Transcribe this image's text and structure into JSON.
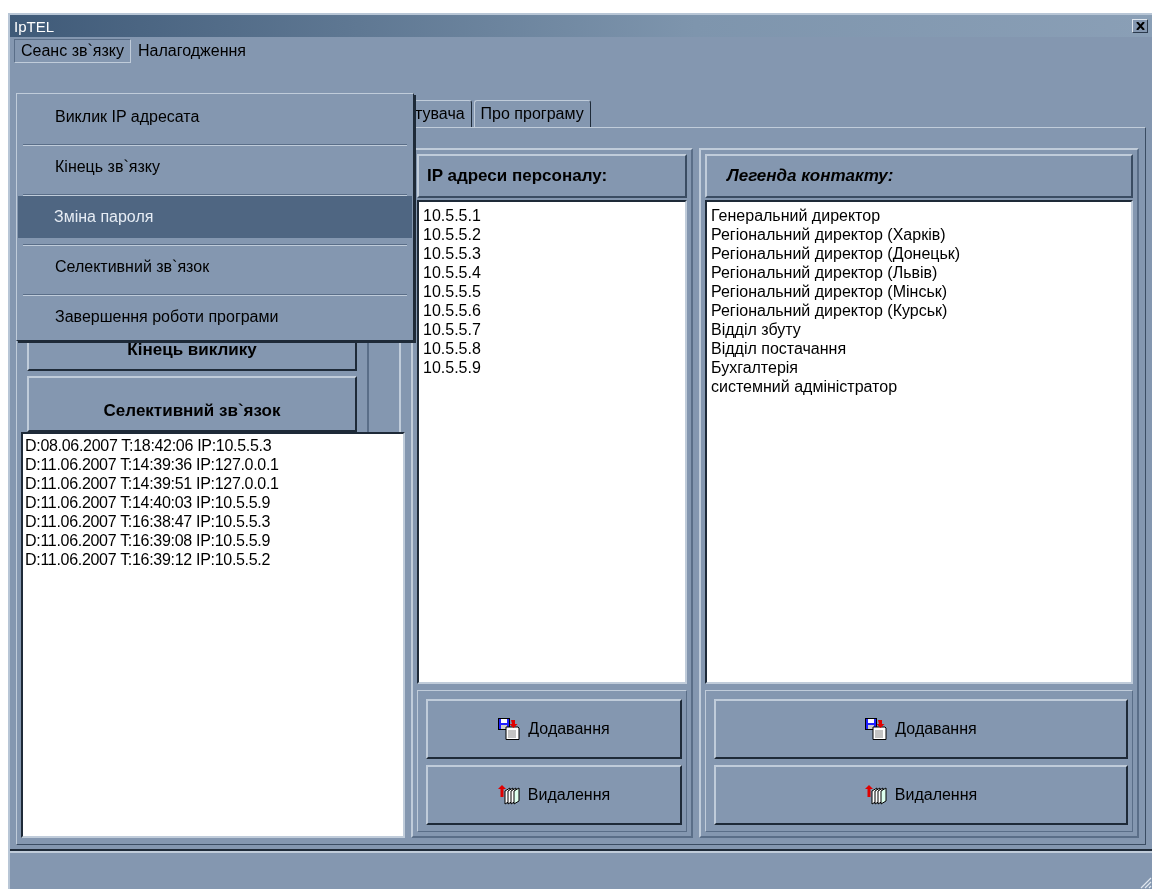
{
  "window": {
    "title": "IpTEL"
  },
  "menu_bar": [
    {
      "label": "Сеанс зв`язку",
      "selected": true
    },
    {
      "label": "Налагодження",
      "selected": false
    }
  ],
  "dropdown": [
    {
      "label": "Виклик IP адресата",
      "selected": false
    },
    {
      "label": "Кінець зв`язку",
      "selected": false
    },
    {
      "label": "Зміна пароля",
      "selected": true
    },
    {
      "label": "Селективний зв`язок",
      "selected": false
    },
    {
      "label": "Завершення роботи програми",
      "selected": false
    }
  ],
  "tabs": [
    {
      "label": "тувача",
      "selected": false
    },
    {
      "label": "Про програму",
      "selected": false
    }
  ],
  "left_buttons": [
    "Кінець виклику",
    "Селективний зв`язок"
  ],
  "call_log": [
    "D:08.06.2007 T:18:42:06 IP:10.5.5.3",
    "D:11.06.2007 T:14:39:36 IP:127.0.0.1",
    "D:11.06.2007 T:14:39:51 IP:127.0.0.1",
    "D:11.06.2007 T:14:40:03 IP:10.5.5.9",
    "D:11.06.2007 T:16:38:47 IP:10.5.5.3",
    "D:11.06.2007 T:16:39:08 IP:10.5.5.9",
    "D:11.06.2007 T:16:39:12 IP:10.5.5.2"
  ],
  "panels": [
    {
      "header": "IP адреси персоналу:",
      "items": [
        "10.5.5.1",
        "10.5.5.2",
        "10.5.5.3",
        "10.5.5.4",
        "10.5.5.5",
        "10.5.5.6",
        "10.5.5.7",
        "10.5.5.8",
        "10.5.5.9"
      ],
      "buttons": [
        {
          "kind": "add",
          "label": "Додавання"
        },
        {
          "kind": "delete",
          "label": "Видалення"
        }
      ]
    },
    {
      "header": "Легенда контакту:",
      "items": [
        "Генеральний директор",
        "Регіональний директор (Харків)",
        "Регіональний директор (Донецьк)",
        "Регіональний директор (Львів)",
        "Регіональний директор (Мінськ)",
        "Регіональний директор (Курськ)",
        "Відділ збуту",
        "Відділ постачання",
        "Бухгалтерія",
        "системний адміністратор"
      ],
      "buttons": [
        {
          "kind": "add",
          "label": "Додавання"
        },
        {
          "kind": "delete",
          "label": "Видалення"
        }
      ]
    }
  ]
}
